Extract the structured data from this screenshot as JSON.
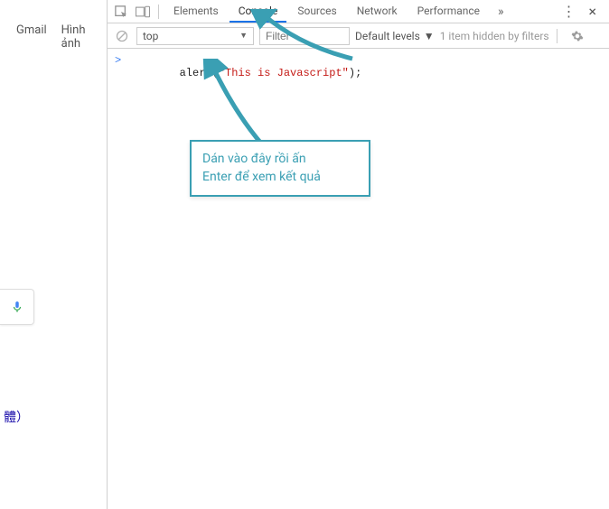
{
  "page": {
    "links": {
      "gmail": "Gmail",
      "images": "Hình ảnh"
    },
    "cjk_text": "體）"
  },
  "devtools": {
    "tabs": {
      "elements": "Elements",
      "console": "Console",
      "sources": "Sources",
      "network": "Network",
      "performance": "Performance",
      "more": "»"
    },
    "kebab": "⋮",
    "close": "×",
    "toolbar": {
      "context": "top",
      "filter_placeholder": "Filter",
      "levels": "Default levels",
      "hidden": "1 item hidden by filters"
    },
    "console": {
      "prompt": ">",
      "code": {
        "fn": "alert",
        "open": "(",
        "str": "\"This is Javascript\"",
        "close": ")",
        "semi": ";"
      }
    }
  },
  "annotation": {
    "line1": "Dán vào đây rồi ấn",
    "line2": "Enter để xem kết quả"
  }
}
